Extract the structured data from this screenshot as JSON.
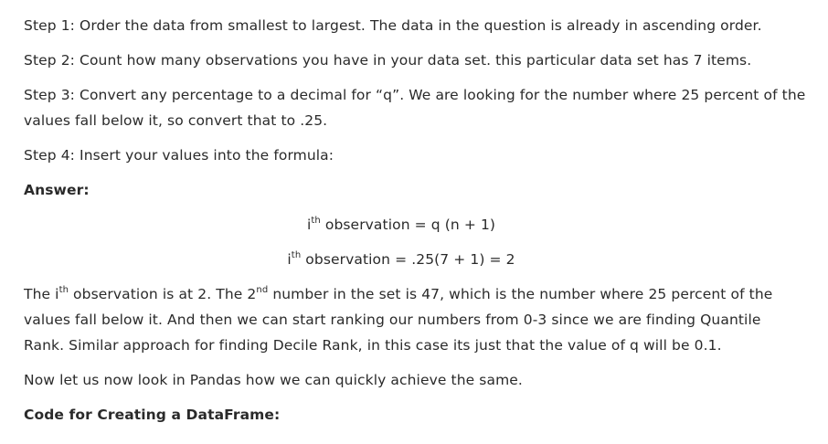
{
  "steps": {
    "step1": "Step 1: Order the data from smallest to largest. The data in the question is already in ascending order.",
    "step2": "Step 2: Count how many observations you have in your data set. this particular data set has 7 items.",
    "step3_line1": "Step 3: Convert any percentage to a decimal for “q”. We are looking for the number where 25 percent of the",
    "step3_line2": "values fall below it, so convert that to .25.",
    "step4": "Step 4: Insert your values into the formula:"
  },
  "answer_heading": "Answer:",
  "formula": {
    "line1_i": "i",
    "line1_sup": "th",
    "line1_rest": " observation = q (n + 1)",
    "line2_i": "i",
    "line2_sup": "th",
    "line2_rest": " observation = .25(7 + 1) = 2"
  },
  "explanation": {
    "part1": "The i",
    "sup1": "th",
    "part2": " observation is at 2. The 2",
    "sup2": "nd",
    "part3": " number in the set is 47, which is the number where 25 percent of the",
    "line2": "values fall below it. And then we can start ranking our numbers from 0-3 since we are finding Quantile",
    "line3": "Rank. Similar approach for finding Decile Rank, in this case its just that the value of q will be 0.1."
  },
  "pandas_intro": "Now let us now look in Pandas how we can quickly achieve the same.",
  "code_heading": "Code for Creating a DataFrame:"
}
